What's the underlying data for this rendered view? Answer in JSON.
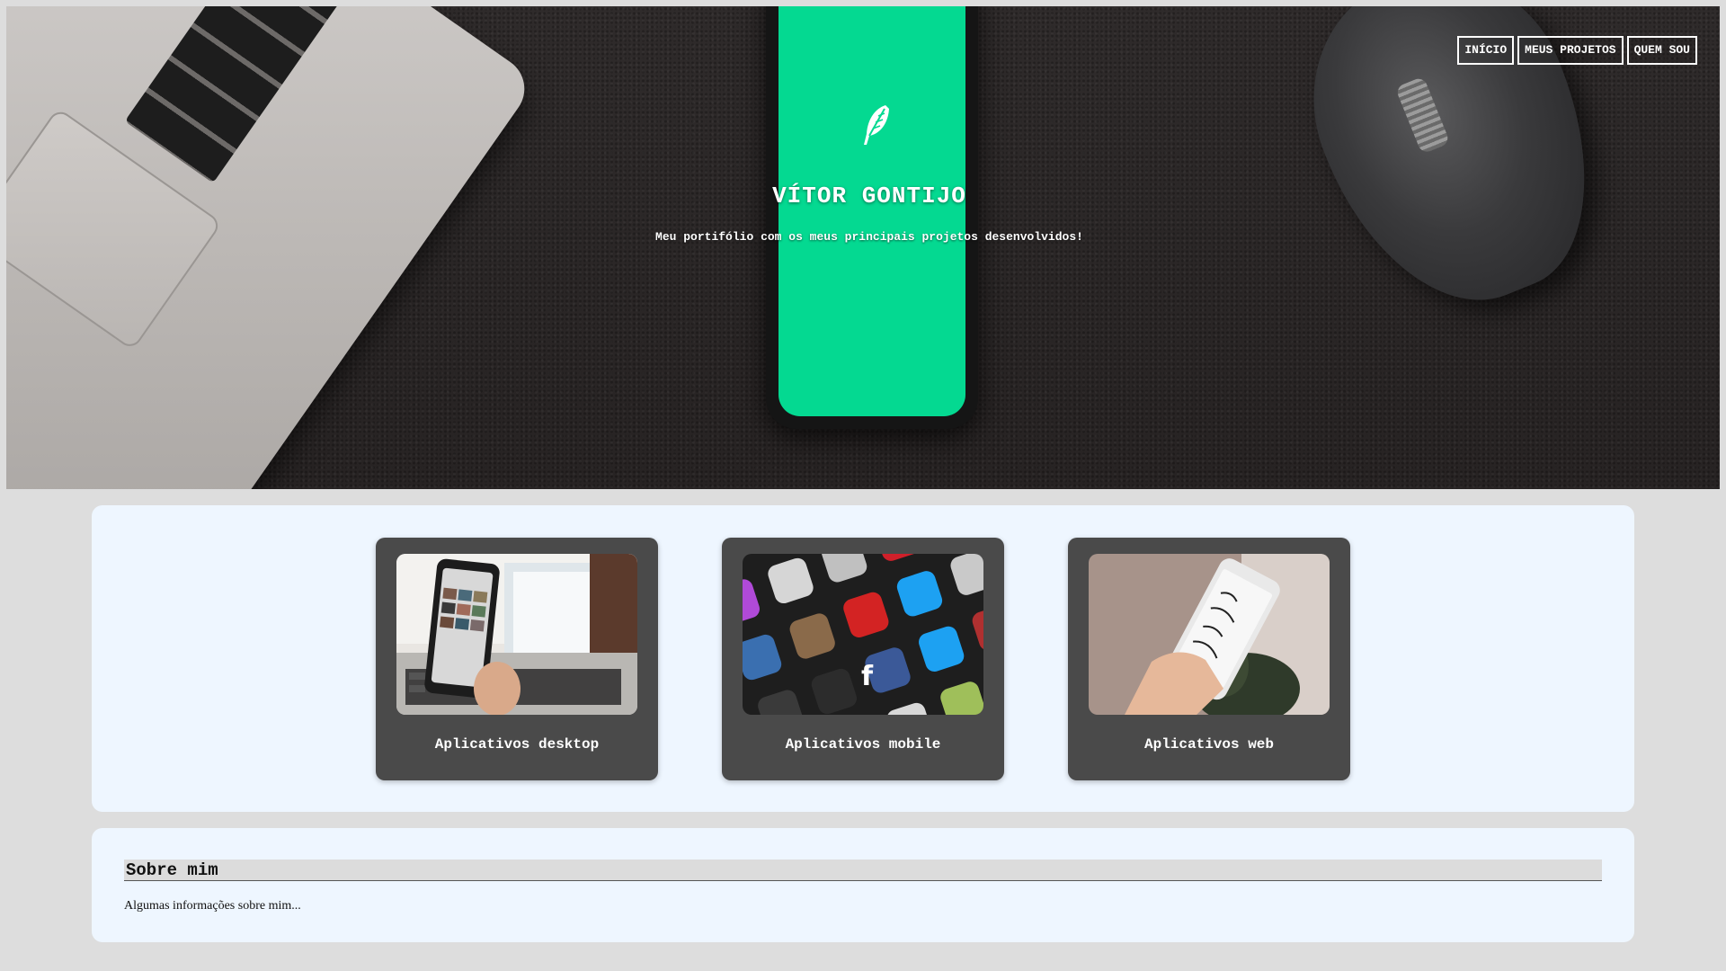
{
  "header": {
    "title": "VÍTOR GONTIJO",
    "subtitle": "Meu portifólio com os meus principais projetos desenvolvidos!",
    "nav": [
      {
        "label": "INÍCIO"
      },
      {
        "label": "MEUS PROJETOS"
      },
      {
        "label": "QUEM SOU"
      }
    ],
    "hero_icon": "feather-icon"
  },
  "projects": {
    "cards": [
      {
        "label": "Aplicativos desktop",
        "image": "phone-over-laptop-photo"
      },
      {
        "label": "Aplicativos mobile",
        "image": "app-icons-photo"
      },
      {
        "label": "Aplicativos web",
        "image": "hand-holding-phone-photo"
      }
    ]
  },
  "about": {
    "title": "Sobre mim",
    "text": "Algumas informações sobre mim..."
  }
}
